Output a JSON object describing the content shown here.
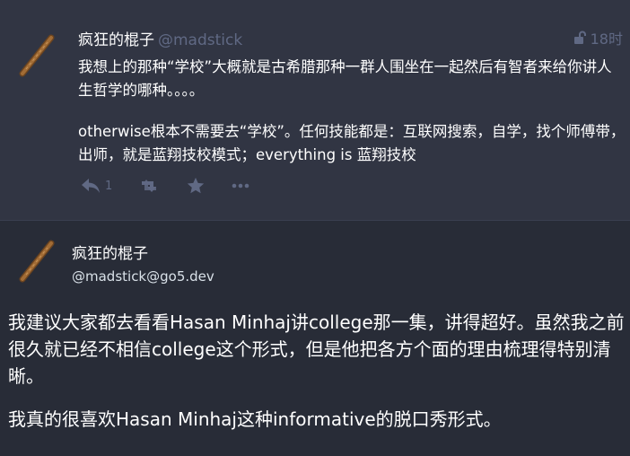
{
  "status": {
    "display_name": "疯狂的棍子",
    "acct": "@madstick",
    "time": "18时",
    "paragraphs": [
      "我想上的那种“学校”大概就是古希腊那种一群人围坐在一起然后有智者来给你讲人生哲学的哪种。。。。",
      "otherwise根本不需要去“学校”。任何技能都是：互联网搜索，自学，找个师傅带，出师，就是蓝翔技校模式；everything is 蓝翔技校"
    ],
    "reply_count": "1"
  },
  "detailed": {
    "display_name": "疯狂的棍子",
    "acct": "@madstick@go5.dev",
    "paragraphs": [
      "我建议大家都去看看Hasan Minhaj讲college那一集，讲得超好。虽然我之前很久就已经不相信college这个形式，但是他把各方个面的理由梳理得特别清晰。",
      "我真的很喜欢Hasan Minhaj这种informative的脱口秀形式。"
    ]
  },
  "icons": {
    "visibility": "unlock-icon",
    "reply": "reply-icon",
    "boost": "retweet-icon",
    "favourite": "star-icon",
    "more": "ellipsis-icon"
  },
  "colors": {
    "background": "#282c37",
    "status_background": "#313543",
    "muted": "#606984"
  }
}
